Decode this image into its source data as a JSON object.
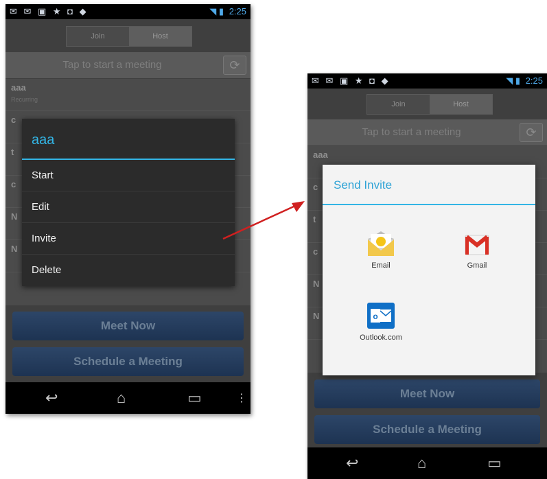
{
  "status_bar": {
    "time": "2:25"
  },
  "segmented_tabs": {
    "join": "Join",
    "host": "Host"
  },
  "tap_bar_label": "Tap to start a meeting",
  "left_list": [
    {
      "title": "aaa",
      "subtitle": "Recurring"
    },
    {
      "title": "c",
      "subtitle": ""
    },
    {
      "title": "t",
      "subtitle": ""
    },
    {
      "title": "c",
      "subtitle": ""
    },
    {
      "title": "N",
      "subtitle": ""
    },
    {
      "title": "N",
      "subtitle": ""
    }
  ],
  "right_list": [
    {
      "title": "aaa"
    },
    {
      "title": "c"
    },
    {
      "title": "t"
    },
    {
      "title": "c"
    },
    {
      "title": "N"
    },
    {
      "title": "N"
    }
  ],
  "context_menu": {
    "title": "aaa",
    "items": [
      "Start",
      "Edit",
      "Invite",
      "Delete"
    ]
  },
  "send_invite": {
    "title": "Send Invite",
    "apps": [
      "Email",
      "Gmail",
      "Outlook.com"
    ]
  },
  "buttons": {
    "meet_now": "Meet Now",
    "schedule": "Schedule a Meeting"
  },
  "colors": {
    "accent": "#33b5e5",
    "arrow": "#d02020",
    "button_blue": "#1d3352"
  }
}
